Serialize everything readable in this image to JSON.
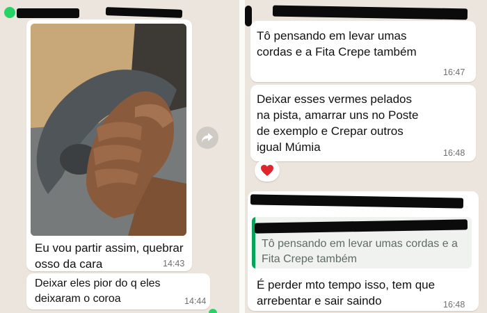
{
  "left_chat": {
    "messages": [
      {
        "text": "Eu vou partir assim, quebrar\nosso da cara",
        "time": "14:43"
      },
      {
        "text": "Deixar eles pior do q eles\ndeixaram o coroa",
        "time": "14:44"
      }
    ]
  },
  "right_chat": {
    "messages": [
      {
        "text": "Tô pensando em levar umas\ncordas e a Fita Crepe também",
        "time": "16:47"
      },
      {
        "text": "Deixar esses vermes pelados\nna pista, amarrar uns no Poste\nde exemplo e Crepar outros\nigual Múmia",
        "time": "16:48"
      },
      {
        "quoted_text": "Tô pensando em levar umas cordas e\na Fita Crepe também",
        "text": "É perder mto tempo isso, tem que\narrebentar e sair saindo",
        "time": "16:48"
      }
    ],
    "reaction_icon": "heart-icon"
  },
  "icons": {
    "forward": "forward-arrow-icon"
  },
  "colors": {
    "bubble": "#ffffff",
    "chat_bg": "#ece5dd",
    "accent_green": "#25d366",
    "quote_bar": "#06a35a",
    "reaction_heart": "#e0262d"
  }
}
